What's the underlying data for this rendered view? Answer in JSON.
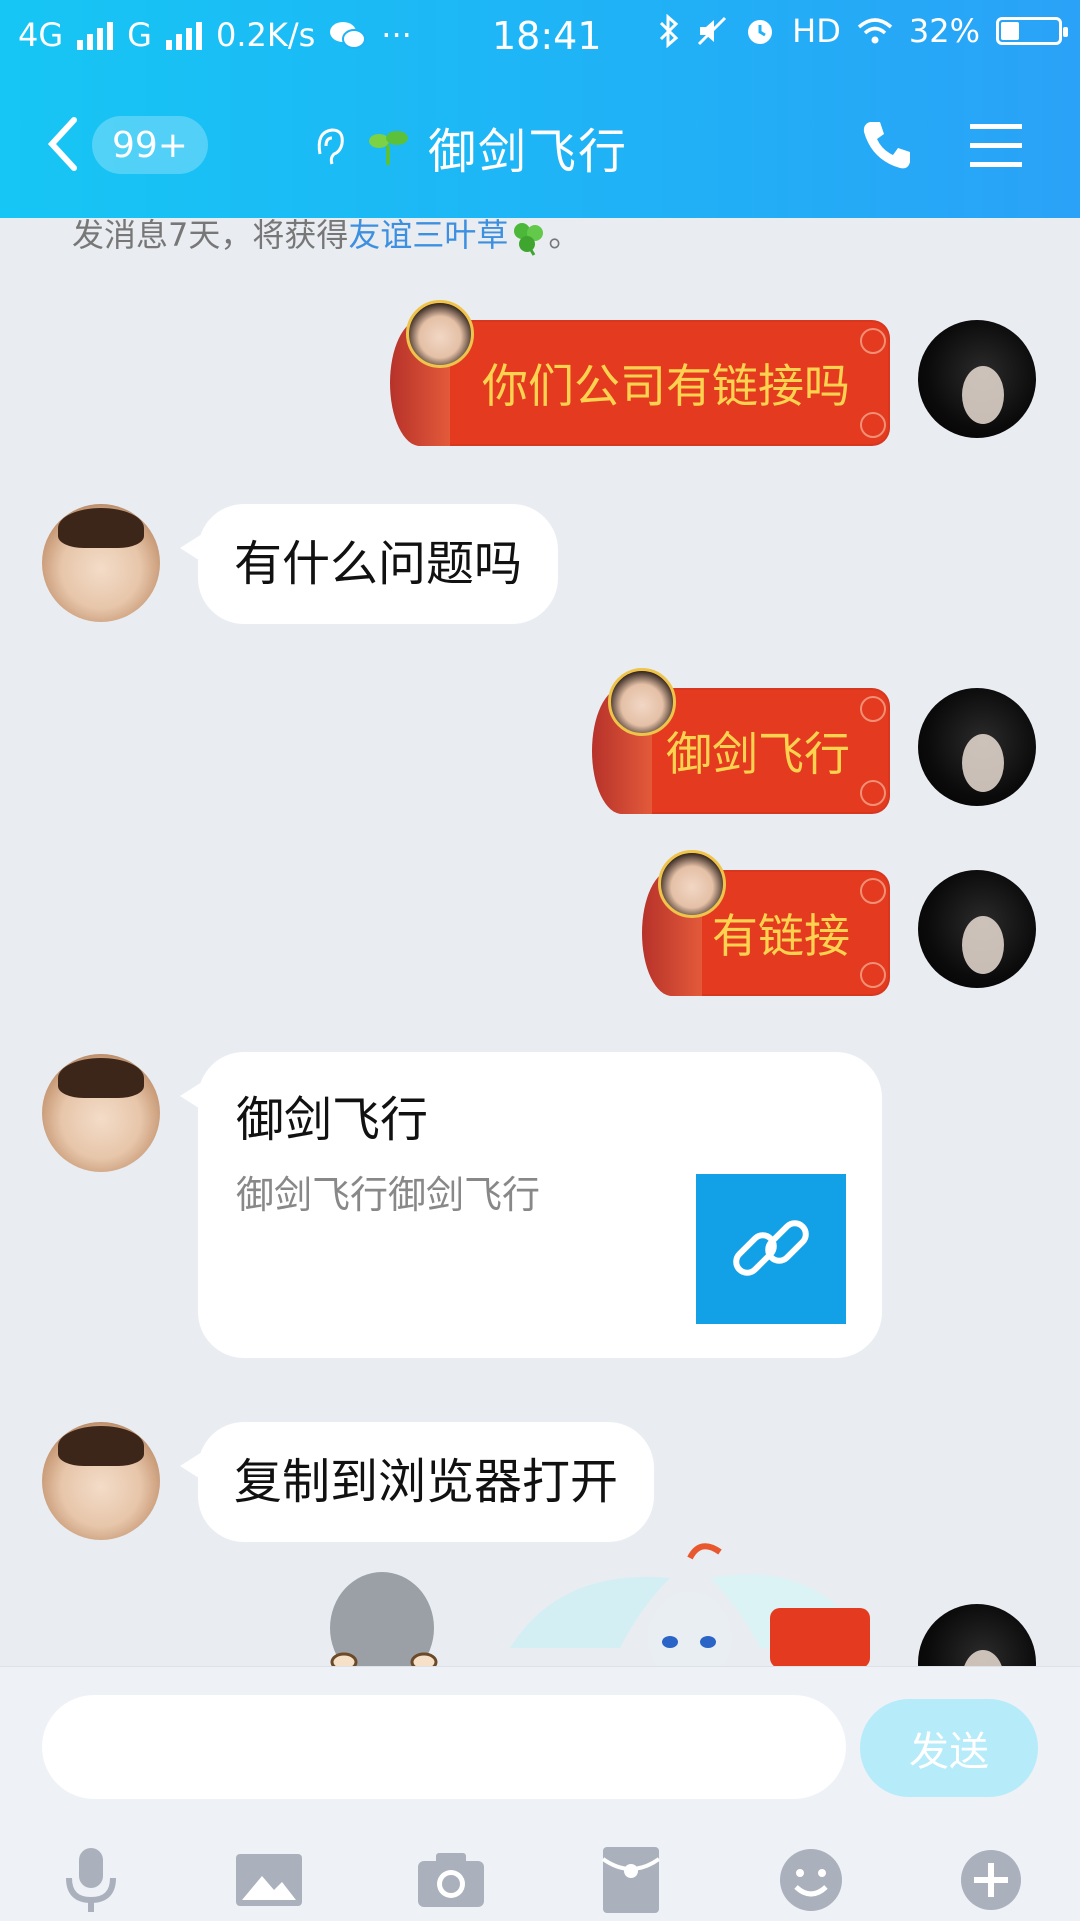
{
  "status_bar": {
    "network_1": "4G",
    "network_2": "G",
    "speed": "0.2K/s",
    "more": "···",
    "time": "18:41",
    "hd": "HD",
    "battery": "32%"
  },
  "header": {
    "unread_count": "99+",
    "title": "御剑飞行"
  },
  "system_tip": {
    "prefix": "发消息7天，将获得",
    "link": "友谊三叶草",
    "suffix": "。"
  },
  "messages": [
    {
      "side": "me",
      "type": "red",
      "text": "你们公司有链接吗"
    },
    {
      "side": "other",
      "type": "text",
      "text": "有什么问题吗"
    },
    {
      "side": "me",
      "type": "red",
      "text": "御剑飞行"
    },
    {
      "side": "me",
      "type": "red",
      "text": "有链接"
    },
    {
      "side": "other",
      "type": "link",
      "title": "御剑飞行",
      "desc": "御剑飞行御剑飞行"
    },
    {
      "side": "other",
      "type": "text",
      "text": "复制到浏览器打开"
    }
  ],
  "input": {
    "value": "",
    "placeholder": "",
    "send_label": "发送"
  },
  "toolbar": [
    "microphone-icon",
    "image-icon",
    "camera-icon",
    "red-packet-icon",
    "emoji-icon",
    "plus-icon"
  ],
  "colors": {
    "header_start": "#16c6f4",
    "header_end": "#2aa2f7",
    "red_bubble": "#e33a20",
    "red_bubble_text": "#ffd34f",
    "link_thumb": "#12a1e6",
    "send_disabled": "#b6ebfa"
  }
}
